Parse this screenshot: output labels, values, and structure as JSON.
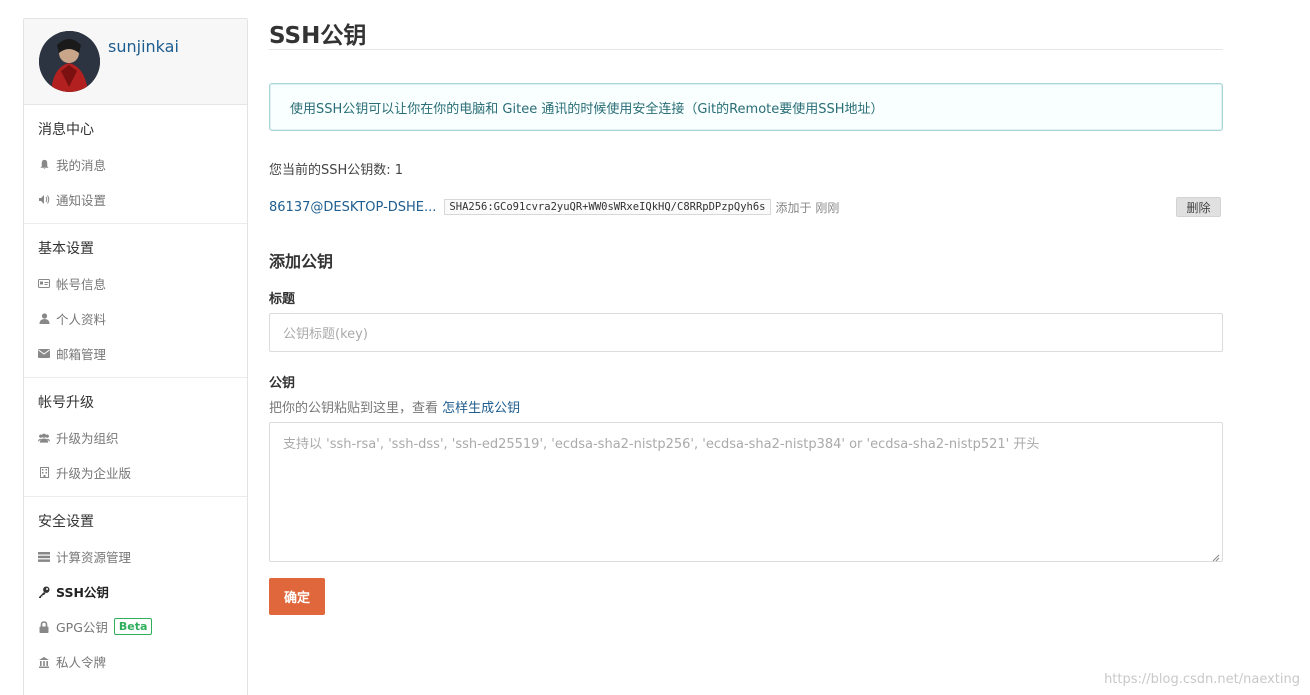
{
  "sidebar": {
    "username": "sunjinkai",
    "sections": [
      {
        "title": "消息中心",
        "items": [
          {
            "label": "我的消息",
            "icon": "bell-icon"
          },
          {
            "label": "通知设置",
            "icon": "speaker-icon"
          }
        ]
      },
      {
        "title": "基本设置",
        "items": [
          {
            "label": "帐号信息",
            "icon": "id-card-icon"
          },
          {
            "label": "个人资料",
            "icon": "user-icon"
          },
          {
            "label": "邮箱管理",
            "icon": "envelope-icon"
          }
        ]
      },
      {
        "title": "帐号升级",
        "items": [
          {
            "label": "升级为组织",
            "icon": "users-icon"
          },
          {
            "label": "升级为企业版",
            "icon": "building-icon"
          }
        ]
      },
      {
        "title": "安全设置",
        "items": [
          {
            "label": "计算资源管理",
            "icon": "server-icon"
          },
          {
            "label": "SSH公钥",
            "icon": "key-icon",
            "active": true
          },
          {
            "label": "GPG公钥",
            "icon": "lock-icon",
            "badge": "Beta"
          },
          {
            "label": "私人令牌",
            "icon": "token-icon"
          }
        ]
      }
    ]
  },
  "main": {
    "title": "SSH公钥",
    "info": "使用SSH公钥可以让你在你的电脑和 Gitee 通讯的时候使用安全连接（Git的Remote要使用SSH地址）",
    "count_label": "您当前的SSH公钥数: 1",
    "key": {
      "name": "86137@DESKTOP-DSHE...",
      "fingerprint": "SHA256:GCo91cvra2yuQR+WW0sWRxeIQkHQ/C8RRpDPzpQyh6s",
      "added": "添加于 刚刚",
      "delete_label": "删除"
    },
    "add_title": "添加公钥",
    "title_label": "标题",
    "title_placeholder": "公钥标题(key)",
    "key_label": "公钥",
    "key_hint": "把你的公钥粘贴到这里，查看 ",
    "key_hint_link": "怎样生成公钥",
    "key_placeholder": "支持以 'ssh-rsa', 'ssh-dss', 'ssh-ed25519', 'ecdsa-sha2-nistp256', 'ecdsa-sha2-nistp384' or 'ecdsa-sha2-nistp521' 开头",
    "submit_label": "确定"
  },
  "watermark": "https://blog.csdn.net/naexting",
  "colors": {
    "accent": "#e0673b",
    "link": "#1e5d8f",
    "info_border": "#a9d4d9",
    "badge": "#2faf5b"
  }
}
